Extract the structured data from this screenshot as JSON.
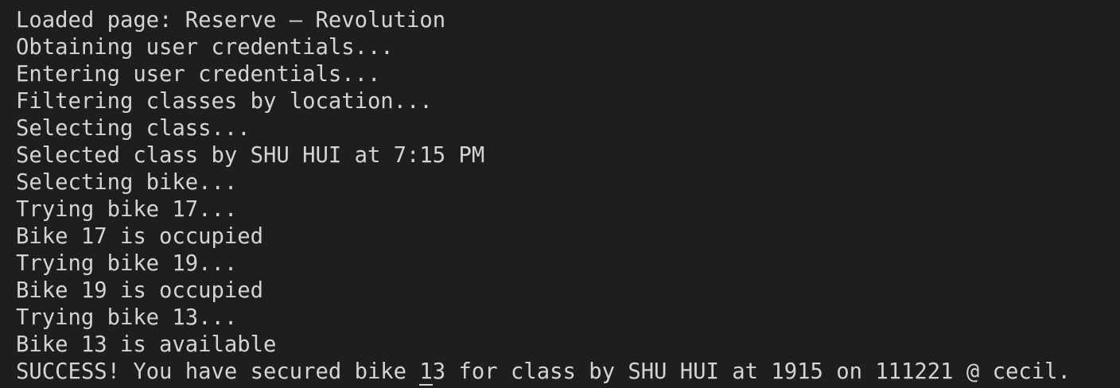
{
  "terminal": {
    "lines": [
      "Loaded page: Reserve – Revolution",
      "Obtaining user credentials...",
      "Entering user credentials...",
      "Filtering classes by location...",
      "Selecting class...",
      "Selected class by SHU HUI at 7:15 PM",
      "Selecting bike...",
      "Trying bike 17...",
      "Bike 17 is occupied",
      "Trying bike 19...",
      "Bike 19 is occupied",
      "Trying bike 13...",
      "Bike 13 is available"
    ],
    "last_line": {
      "before_cursor": "SUCCESS! You have secured bike ",
      "cursor_char": "1",
      "after_cursor": "3 for class by SHU HUI at 1915 on 111221 @ cecil."
    }
  },
  "colors": {
    "background": "#1e1e1e",
    "text": "#d4d4d4"
  }
}
